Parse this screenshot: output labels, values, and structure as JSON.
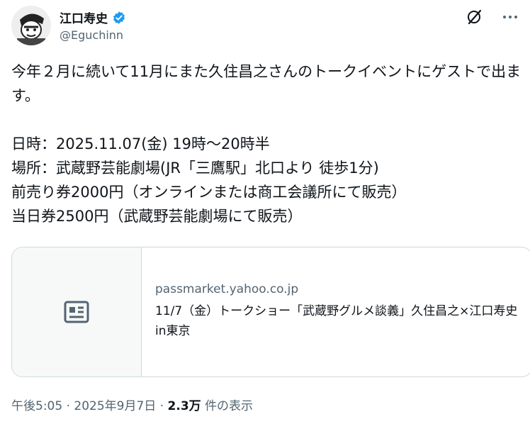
{
  "author": {
    "name": "江口寿史",
    "handle": "@Eguchinn",
    "verified": true
  },
  "tweet": {
    "lines": [
      "今年２月に続いて11月にまた久住昌之さんのトークイベントにゲストで出ます。",
      "",
      "日時：2025.11.07(金) 19時〜20時半",
      "場所：武蔵野芸能劇場(JR「三鷹駅」北口より 徒歩1分)",
      "前売り券2000円（オンラインまたは商工会議所にて販売）",
      "当日券2500円（武蔵野芸能劇場にて販売）"
    ]
  },
  "card": {
    "domain": "passmarket.yahoo.co.jp",
    "title": "11/7（金）トークショー「武蔵野グルメ談義」久住昌之×江口寿史 in東京",
    "icon": "article-icon"
  },
  "meta": {
    "time": "午後5:05",
    "date": "2025年9月7日",
    "views": "2.3万",
    "views_label": "件の表示"
  },
  "icons": {
    "verified": "verified-badge-icon",
    "grok": "grok-icon",
    "more": "more-icon"
  },
  "colors": {
    "verified": "#1d9bf0",
    "secondary": "#536471",
    "border": "#cfd9de"
  }
}
